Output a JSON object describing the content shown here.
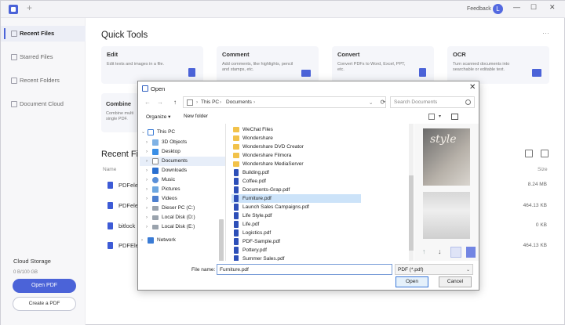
{
  "app": {
    "feedback_label": "Feedback",
    "avatar_letter": "L",
    "window_controls": [
      "—",
      "☐",
      "✕"
    ],
    "accent": "#4b63d8"
  },
  "sidebar": {
    "items": [
      {
        "label": "Recent Files",
        "active": true
      },
      {
        "label": "Starred Files",
        "active": false
      },
      {
        "label": "Recent Folders",
        "active": false
      },
      {
        "label": "Document Cloud",
        "active": false
      }
    ],
    "cloud_storage_title": "Cloud Storage",
    "cloud_storage_value": "0 B/100 GB",
    "open_pdf_label": "Open PDF",
    "create_pdf_label": "Create a PDF"
  },
  "quick_tools": {
    "title": "Quick Tools",
    "cards": [
      {
        "title": "Edit",
        "desc": "Edit texts and images in a file."
      },
      {
        "title": "Comment",
        "desc": "Add comments, like highlights, pencil and stamps, etc."
      },
      {
        "title": "Convert",
        "desc": "Convert PDFs to Word, Excel, PPT, etc."
      },
      {
        "title": "OCR",
        "desc": "Turn scanned documents into searchable or editable text."
      }
    ],
    "combine": {
      "title": "Combine",
      "desc": "Combine multi single PDF."
    }
  },
  "recent": {
    "title": "Recent Fil",
    "name_header": "Name",
    "size_header": "Size",
    "rows": [
      {
        "name": "PDFele",
        "size": "8.24 MB"
      },
      {
        "name": "PDFele",
        "size": "464.13 KB"
      },
      {
        "name": "bitlock",
        "size": "0 KB"
      },
      {
        "name": "PDFEle",
        "size": "464.13 KB"
      }
    ]
  },
  "dialog": {
    "title": "Open",
    "close": "✕",
    "nav_arrows": [
      "←",
      "→",
      "↑"
    ],
    "address": [
      "This PC",
      "›",
      "Documents",
      "›"
    ],
    "search_placeholder": "Search Documents",
    "organize_label": "Organize ▾",
    "new_folder_label": "New folder",
    "help": "?",
    "nav_items": [
      {
        "label": "This PC",
        "icon": "pc",
        "chev": "⌄",
        "indent": 0,
        "selected": false
      },
      {
        "label": "3D Objects",
        "icon": "folder",
        "chev": "›",
        "indent": 1,
        "selected": false
      },
      {
        "label": "Desktop",
        "icon": "folder-blue",
        "chev": "›",
        "indent": 1,
        "selected": false
      },
      {
        "label": "Documents",
        "icon": "folder",
        "chev": "›",
        "indent": 1,
        "selected": true
      },
      {
        "label": "Downloads",
        "icon": "download",
        "chev": "›",
        "indent": 1,
        "selected": false
      },
      {
        "label": "Music",
        "icon": "music",
        "chev": "›",
        "indent": 1,
        "selected": false
      },
      {
        "label": "Pictures",
        "icon": "pictures",
        "chev": "›",
        "indent": 1,
        "selected": false
      },
      {
        "label": "Videos",
        "icon": "videos",
        "chev": "›",
        "indent": 1,
        "selected": false
      },
      {
        "label": "Dieser PC (C:)",
        "icon": "drive",
        "chev": "›",
        "indent": 1,
        "selected": false
      },
      {
        "label": "Local Disk (D:)",
        "icon": "drive",
        "chev": "›",
        "indent": 1,
        "selected": false
      },
      {
        "label": "Local Disk (E:)",
        "icon": "drive",
        "chev": "›",
        "indent": 1,
        "selected": false
      },
      {
        "label": "Network",
        "icon": "network",
        "chev": "›",
        "indent": 0,
        "selected": false
      }
    ],
    "files": [
      {
        "name": "WeChat Files",
        "type": "folder",
        "selected": false
      },
      {
        "name": "Wondershare",
        "type": "folder",
        "selected": false
      },
      {
        "name": "Wondershare DVD Creator",
        "type": "folder",
        "selected": false
      },
      {
        "name": "Wondershare Filmora",
        "type": "folder",
        "selected": false
      },
      {
        "name": "Wondershare MediaServer",
        "type": "folder",
        "selected": false
      },
      {
        "name": "Building.pdf",
        "type": "pdf",
        "selected": false
      },
      {
        "name": "Coffee.pdf",
        "type": "pdf",
        "selected": false
      },
      {
        "name": "Documents-Grap.pdf",
        "type": "pdf",
        "selected": false
      },
      {
        "name": "Furniture.pdf",
        "type": "pdf",
        "selected": true
      },
      {
        "name": "Launch Sales Campaigns.pdf",
        "type": "pdf",
        "selected": false
      },
      {
        "name": "Life Style.pdf",
        "type": "pdf",
        "selected": false
      },
      {
        "name": "Life.pdf",
        "type": "pdf",
        "selected": false
      },
      {
        "name": "Logistics.pdf",
        "type": "pdf",
        "selected": false
      },
      {
        "name": "PDF-Sample.pdf",
        "type": "pdf",
        "selected": false
      },
      {
        "name": "Pottery.pdf",
        "type": "pdf",
        "selected": false
      },
      {
        "name": "Summer Sales.pdf",
        "type": "pdf",
        "selected": false
      }
    ],
    "preview_text": "style",
    "file_name_label": "File name:",
    "file_name_value": "Furniture.pdf",
    "file_type_value": "PDF (*.pdf)",
    "open_button": "Open",
    "cancel_button": "Cancel"
  }
}
